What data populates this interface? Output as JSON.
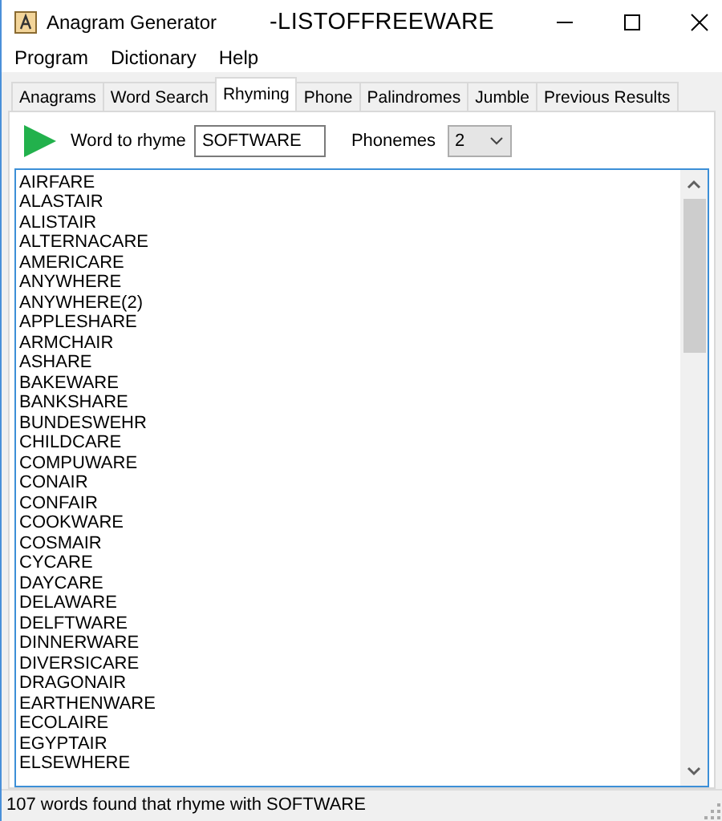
{
  "window": {
    "title": "Anagram Generator",
    "subtitle": "-LISTOFFREEWARE"
  },
  "menu": [
    "Program",
    "Dictionary",
    "Help"
  ],
  "tabs": [
    {
      "label": "Anagrams",
      "selected": false
    },
    {
      "label": "Word Search",
      "selected": false
    },
    {
      "label": "Rhyming",
      "selected": true
    },
    {
      "label": "Phone",
      "selected": false
    },
    {
      "label": "Palindromes",
      "selected": false
    },
    {
      "label": "Jumble",
      "selected": false
    },
    {
      "label": "Previous Results",
      "selected": false
    }
  ],
  "word_field": {
    "label": "Word to rhyme",
    "value": "SOFTWARE"
  },
  "phonemes": {
    "label": "Phonemes",
    "value": "2"
  },
  "results": [
    "AIRFARE",
    "ALASTAIR",
    "ALISTAIR",
    "ALTERNACARE",
    "AMERICARE",
    "ANYWHERE",
    "ANYWHERE(2)",
    "APPLESHARE",
    "ARMCHAIR",
    "ASHARE",
    "BAKEWARE",
    "BANKSHARE",
    "BUNDESWEHR",
    "CHILDCARE",
    "COMPUWARE",
    "CONAIR",
    "CONFAIR",
    "COOKWARE",
    "COSMAIR",
    "CYCARE",
    "DAYCARE",
    "DELAWARE",
    "DELFTWARE",
    "DINNERWARE",
    "DIVERSICARE",
    "DRAGONAIR",
    "EARTHENWARE",
    "ECOLAIRE",
    "EGYPTAIR",
    "ELSEWHERE"
  ],
  "status_bar": "107 words found that rhyme with SOFTWARE"
}
